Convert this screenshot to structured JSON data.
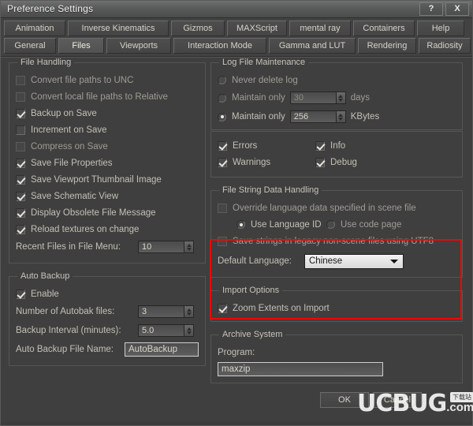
{
  "window": {
    "title": "Preference Settings",
    "help_button": "?",
    "close_button": "X"
  },
  "tabs": {
    "row1": [
      {
        "label": "Animation",
        "selected": false
      },
      {
        "label": "Inverse Kinematics",
        "selected": false
      },
      {
        "label": "Gizmos",
        "selected": false
      },
      {
        "label": "MAXScript",
        "selected": false
      },
      {
        "label": "mental ray",
        "selected": false
      },
      {
        "label": "Containers",
        "selected": false
      },
      {
        "label": "Help",
        "selected": false
      }
    ],
    "row2": [
      {
        "label": "General",
        "selected": false
      },
      {
        "label": "Files",
        "selected": true
      },
      {
        "label": "Viewports",
        "selected": false
      },
      {
        "label": "Interaction Mode",
        "selected": false
      },
      {
        "label": "Gamma and LUT",
        "selected": false
      },
      {
        "label": "Rendering",
        "selected": false
      },
      {
        "label": "Radiosity",
        "selected": false
      }
    ]
  },
  "file_handling": {
    "legend": "File Handling",
    "checkboxes": [
      {
        "label": "Convert file paths to UNC",
        "checked": false
      },
      {
        "label": "Convert local file paths to Relative",
        "checked": false
      },
      {
        "label": "Backup on Save",
        "checked": true
      },
      {
        "label": "Increment on Save",
        "checked": false
      },
      {
        "label": "Compress on Save",
        "checked": false
      },
      {
        "label": "Save File Properties",
        "checked": true
      },
      {
        "label": "Save Viewport Thumbnail Image",
        "checked": true
      },
      {
        "label": "Save Schematic View",
        "checked": true
      },
      {
        "label": "Display Obsolete File Message",
        "checked": true
      },
      {
        "label": "Reload textures on change",
        "checked": true
      }
    ],
    "recent_files_label": "Recent Files in File Menu:",
    "recent_files_value": "10"
  },
  "auto_backup": {
    "legend": "Auto Backup",
    "enable_label": "Enable",
    "enable_checked": true,
    "num_files_label": "Number of Autobak files:",
    "num_files_value": "3",
    "interval_label": "Backup Interval (minutes):",
    "interval_value": "5.0",
    "file_name_label": "Auto Backup File Name:",
    "file_name_value": "AutoBackup"
  },
  "log_file": {
    "legend": "Log File Maintenance",
    "never_delete_label": "Never delete log",
    "never_delete_selected": false,
    "days_label": "Maintain only",
    "days_value": "30",
    "days_unit": "days",
    "days_selected": false,
    "kbytes_label": "Maintain only",
    "kbytes_value": "256",
    "kbytes_unit": "KBytes",
    "kbytes_selected": true,
    "log_types": [
      {
        "label": "Errors",
        "checked": true
      },
      {
        "label": "Info",
        "checked": true
      },
      {
        "label": "Warnings",
        "checked": true
      },
      {
        "label": "Debug",
        "checked": true
      }
    ]
  },
  "file_string": {
    "legend": "File String Data Handling",
    "override_label": "Override language data specified in scene file",
    "override_checked": false,
    "use_language_id_label": "Use Language ID",
    "use_language_id_selected": true,
    "use_code_page_label": "Use code page",
    "use_code_page_selected": false,
    "legacy_utf8_label": "Save strings in legacy non-scene files using UTF8",
    "legacy_utf8_checked": false,
    "default_language_label": "Default Language:",
    "default_language_value": "Chinese",
    "highlight_color": "#f00606"
  },
  "import_options": {
    "legend": "Import Options",
    "zoom_extents_label": "Zoom Extents on Import",
    "zoom_extents_checked": true
  },
  "archive_system": {
    "legend": "Archive System",
    "program_label": "Program:",
    "program_value": "maxzip"
  },
  "footer": {
    "ok_label": "OK",
    "cancel_label": "Cancel"
  },
  "watermark": {
    "main_text": "UCBUG",
    "suffix": ".com",
    "badge": "下载站"
  }
}
